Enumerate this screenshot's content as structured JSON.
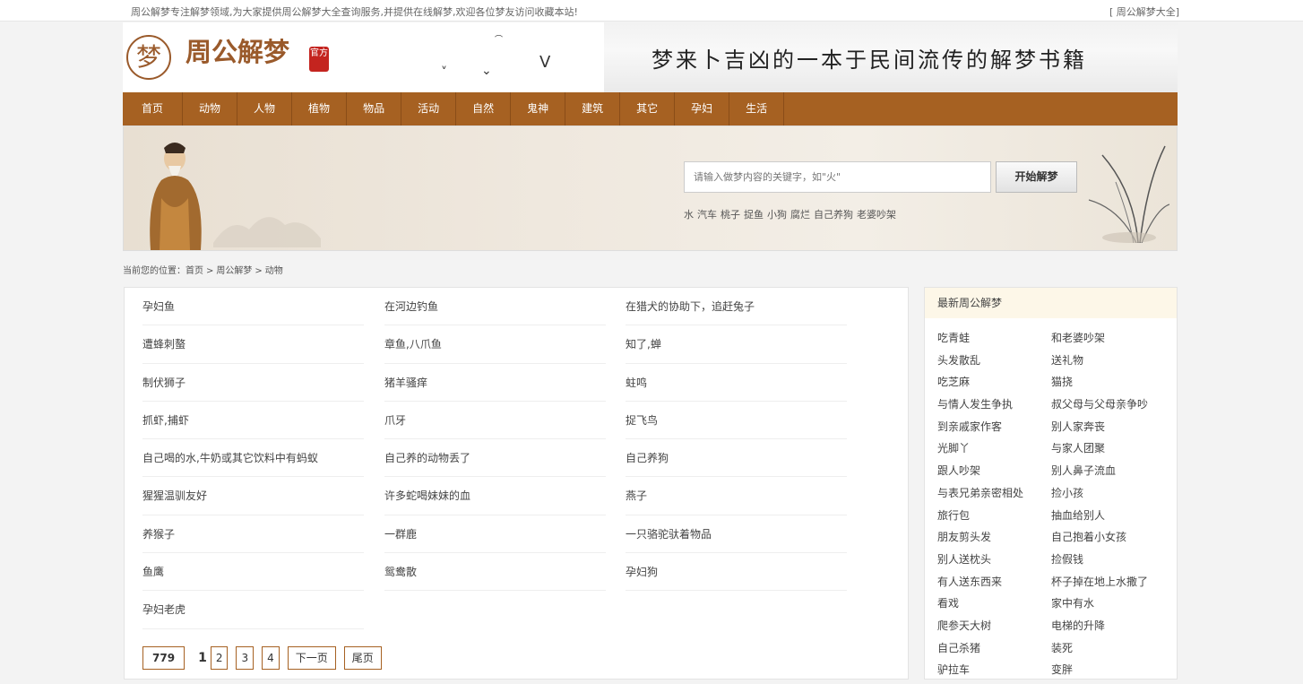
{
  "topbar": {
    "notice": "周公解梦专注解梦领域,为大家提供周公解梦大全查询服务,并提供在线解梦,欢迎各位梦友访问收藏本站!",
    "link": "[ 周公解梦大全]"
  },
  "header": {
    "logo_char": "梦",
    "logo_text": "周公解梦",
    "seal": "官方",
    "slogan": "梦来卜吉凶的一本于民间流传的解梦书籍"
  },
  "nav": [
    "首页",
    "动物",
    "人物",
    "植物",
    "物品",
    "活动",
    "自然",
    "鬼神",
    "建筑",
    "其它",
    "孕妇",
    "生活"
  ],
  "search": {
    "placeholder": "请输入做梦内容的关键字，如\"火\"",
    "button": "开始解梦",
    "hot": [
      "水",
      "汽车",
      "桃子",
      "捉鱼",
      "小狗",
      "腐烂",
      "自己养狗",
      "老婆吵架"
    ]
  },
  "breadcrumb": {
    "prefix": "当前您的位置：",
    "items": [
      "首页",
      "周公解梦",
      "动物"
    ],
    "sep": ">"
  },
  "list": {
    "col1": [
      "孕妇鱼",
      "遭蜂刺螯",
      "制伏狮子",
      "抓虾,捕虾",
      "自己喝的水,牛奶或其它饮料中有蚂蚁",
      "猩猩温驯友好",
      "养猴子",
      "鱼鹰",
      "孕妇老虎"
    ],
    "col2": [
      "在河边钓鱼",
      "章鱼,八爪鱼",
      "猪羊骚痒",
      "爪牙",
      "自己养的动物丢了",
      "许多蛇喝妹妹的血",
      "一群鹿",
      "鸳鸯散"
    ],
    "col3": [
      "在猎犬的协助下，追赶兔子",
      "知了,蝉",
      "蛀鸣",
      "捉飞鸟",
      "自己养狗",
      "燕子",
      "一只骆驼驮着物品",
      "孕妇狗"
    ]
  },
  "pager": {
    "total": "779",
    "current": "1",
    "pages": [
      "2",
      "3",
      "4"
    ],
    "next": "下一页",
    "last": "尾页"
  },
  "sidebar": {
    "title": "最新周公解梦",
    "left": [
      "吃青蛙",
      "头发散乱",
      "吃芝麻",
      "与情人发生争执",
      "到亲戚家作客",
      "光脚丫",
      "跟人吵架",
      "与表兄弟亲密相处",
      "旅行包",
      "朋友剪头发",
      "别人送枕头",
      "有人送东西来",
      "看戏",
      "爬参天大树",
      "自己杀猪",
      "驴拉车"
    ],
    "right": [
      "和老婆吵架",
      "送礼物",
      "猫挠",
      "叔父母与父母亲争吵",
      "别人家奔丧",
      "与家人团聚",
      "别人鼻子流血",
      "捡小孩",
      "抽血给别人",
      "自己抱着小女孩",
      "捡假钱",
      "杯子掉在地上水撒了",
      "家中有水",
      "电梯的升降",
      "装死",
      "变胖"
    ]
  }
}
